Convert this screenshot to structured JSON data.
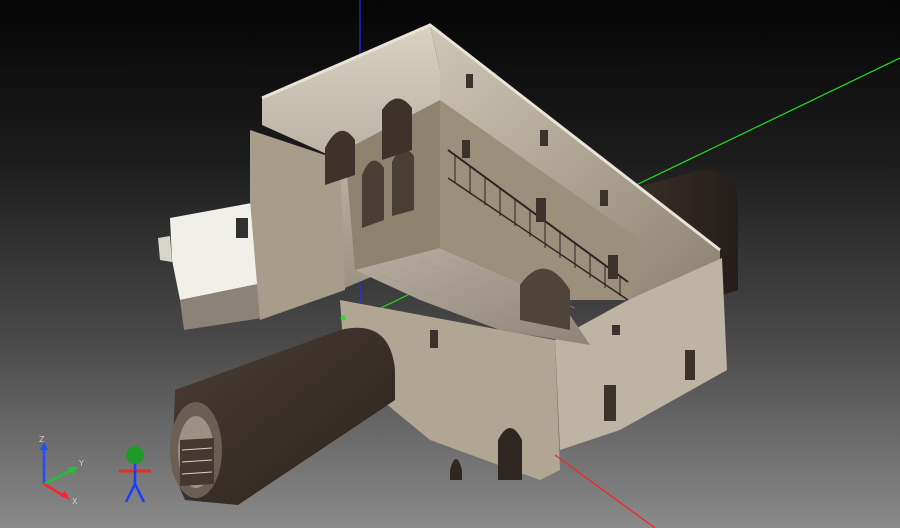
{
  "viewport": {
    "background_top": "#050505",
    "background_bottom": "#8a8a8a",
    "object": "point-cloud-building-scan"
  },
  "axes": {
    "x_color": "#ff2020",
    "y_color": "#20d020",
    "z_color": "#2020ff"
  },
  "triad": {
    "z_label": "Z",
    "y_label": "Y",
    "x_label": "X",
    "z_color": "#1f4fff",
    "y_color": "#22c033",
    "x_color": "#ff2233"
  },
  "camera_widget": {
    "icon": "camera-person-icon",
    "head_color": "#1f9a2a",
    "body_color": "#1a3cff",
    "arm_color": "#e03020"
  }
}
